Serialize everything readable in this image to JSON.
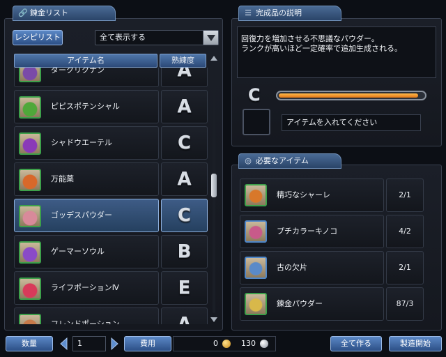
{
  "left_panel": {
    "title": "錬金リスト",
    "recipe_tab": "レシピリスト",
    "filter_selected": "全て表示する",
    "columns": {
      "item": "アイテム名",
      "grade": "熟練度"
    },
    "rows": [
      {
        "name": "ダークリクナン",
        "grade": "A",
        "icon": "dark-potion-icon",
        "color": "#7a4aa8"
      },
      {
        "name": "ピピスポテンシャル",
        "grade": "A",
        "icon": "green-potion-icon",
        "color": "#4fa83a"
      },
      {
        "name": "シャドウエーテル",
        "grade": "C",
        "icon": "purple-potion-icon",
        "color": "#8a3ab8"
      },
      {
        "name": "万能薬",
        "grade": "A",
        "icon": "orange-potion-icon",
        "color": "#d8682a"
      },
      {
        "name": "ゴッデスパウダー",
        "grade": "C",
        "icon": "powder-dish-icon",
        "color": "#d88a9a",
        "selected": true
      },
      {
        "name": "ゲーマーソウル",
        "grade": "B",
        "icon": "purple-orb-icon",
        "color": "#8a4ac8"
      },
      {
        "name": "ライフポーションⅣ",
        "grade": "E",
        "icon": "life-potion-icon",
        "color": "#d83a5a"
      },
      {
        "name": "フレンドポーション",
        "grade": "A",
        "icon": "flask-icon",
        "color": "#c87a4a"
      }
    ]
  },
  "right_panel": {
    "desc_title": "完成品の説明",
    "description_line1": "回復力を増加させる不思議なパウダー。",
    "description_line2": "ランクが高いほど一定確率で追加生成される。",
    "rank": "C",
    "slot_text": "アイテムを入れてください",
    "progress": 0.96,
    "req_title": "必要なアイテム",
    "requirements": [
      {
        "name": "精巧なシャーレ",
        "count": "2/1",
        "icon": "petri-dish-icon",
        "color": "#d8782a"
      },
      {
        "name": "プチカラーキノコ",
        "count": "4/2",
        "icon": "mushroom-icon",
        "color": "#c85a8a"
      },
      {
        "name": "古の欠片",
        "count": "2/1",
        "icon": "crystal-shard-icon",
        "color": "#5a8ac8"
      },
      {
        "name": "錬金パウダー",
        "count": "87/3",
        "icon": "golden-powder-icon",
        "color": "#d8b84a"
      }
    ]
  },
  "bottom_bar": {
    "quantity_label": "数量",
    "quantity_value": "1",
    "cost_label": "費用",
    "gold": "0",
    "silver": "130",
    "make_all": "全て作る",
    "start": "製造開始"
  }
}
